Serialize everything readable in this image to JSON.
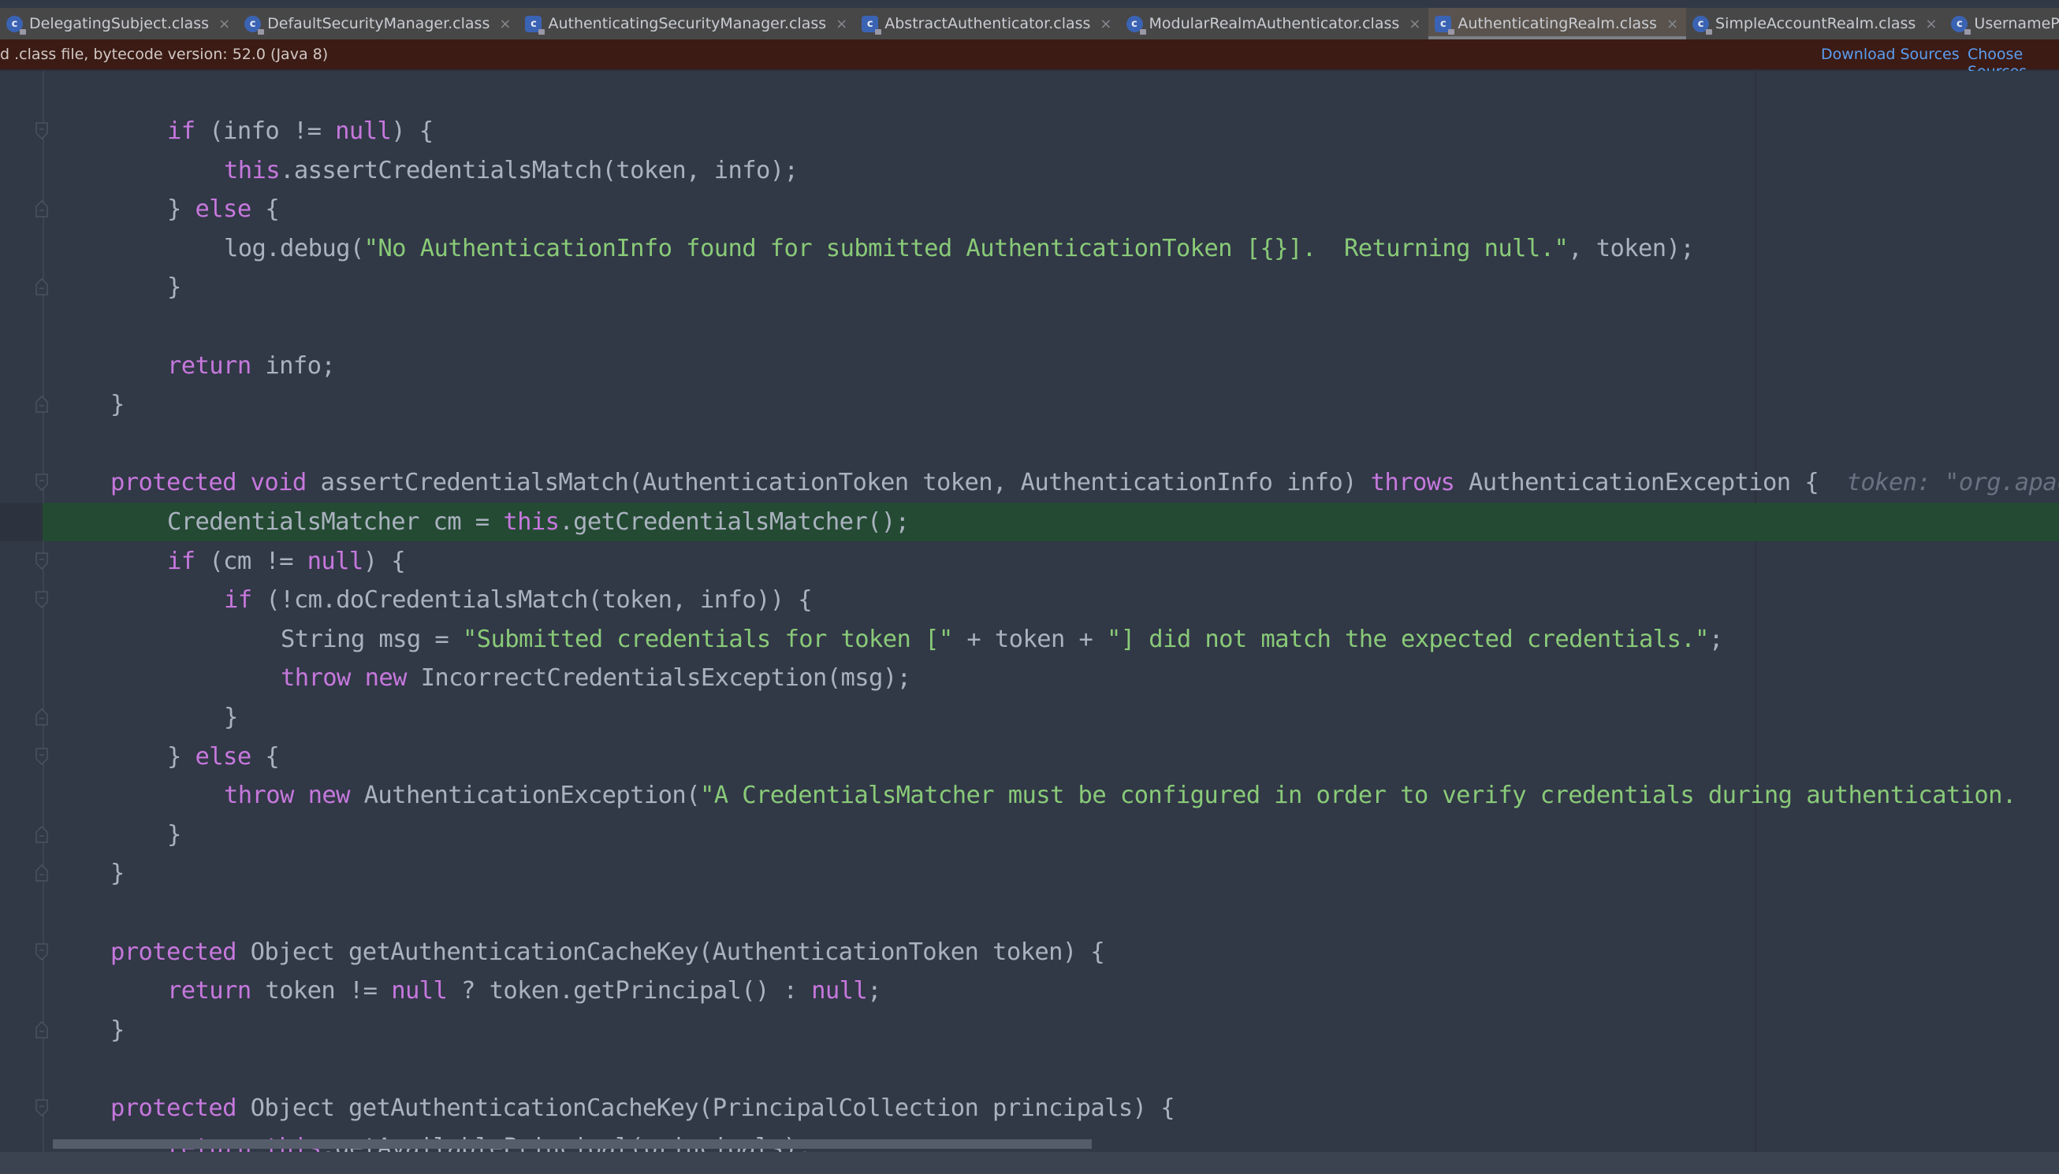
{
  "tabs": [
    {
      "label": "DelegatingSubject.class",
      "icon": "class-icon",
      "active": false
    },
    {
      "label": "DefaultSecurityManager.class",
      "icon": "class-icon",
      "active": false
    },
    {
      "label": "AuthenticatingSecurityManager.class",
      "icon": "abstract-class-icon",
      "active": false
    },
    {
      "label": "AbstractAuthenticator.class",
      "icon": "abstract-class-icon",
      "active": false
    },
    {
      "label": "ModularRealmAuthenticator.class",
      "icon": "class-icon",
      "active": false
    },
    {
      "label": "AuthenticatingRealm.class",
      "icon": "abstract-class-icon",
      "active": true
    },
    {
      "label": "SimpleAccountRealm.class",
      "icon": "class-icon",
      "active": false
    },
    {
      "label": "UsernamePasswordToken.class",
      "icon": "class-icon",
      "active": false
    }
  ],
  "tab_close_glyph": "×",
  "tab_icon_letter": "c",
  "notice": {
    "text": "d .class file, bytecode version: 52.0 (Java 8)",
    "download_sources": "Download Sources",
    "choose_sources": "Choose Sources..."
  },
  "editor": {
    "highlighted_line_index": 10,
    "lines": [
      {
        "indent": 1,
        "tokens": [
          {
            "t": "if",
            "c": "kw"
          },
          {
            "t": " (info != "
          },
          {
            "t": "null",
            "c": "kw"
          },
          {
            "t": ") {"
          }
        ]
      },
      {
        "indent": 2,
        "tokens": [
          {
            "t": "this",
            "c": "kw"
          },
          {
            "t": ".assertCredentialsMatch(token, info);"
          }
        ]
      },
      {
        "indent": 1,
        "tokens": [
          {
            "t": "} "
          },
          {
            "t": "else",
            "c": "kw"
          },
          {
            "t": " {"
          }
        ]
      },
      {
        "indent": 2,
        "tokens": [
          {
            "t": "log.debug("
          },
          {
            "t": "\"No AuthenticationInfo found for submitted AuthenticationToken [{}].  Returning null.\"",
            "c": "str"
          },
          {
            "t": ", token);"
          }
        ]
      },
      {
        "indent": 1,
        "tokens": [
          {
            "t": "}"
          }
        ]
      },
      {
        "indent": 0,
        "tokens": []
      },
      {
        "indent": 1,
        "tokens": [
          {
            "t": "return",
            "c": "kw"
          },
          {
            "t": " info;"
          }
        ]
      },
      {
        "indent": 0,
        "tokens": [
          {
            "t": "}"
          }
        ]
      },
      {
        "indent": 0,
        "tokens": []
      },
      {
        "indent": 0,
        "tokens": [
          {
            "t": "protected",
            "c": "kw"
          },
          {
            "t": " "
          },
          {
            "t": "void",
            "c": "kw"
          },
          {
            "t": " assertCredentialsMatch(AuthenticationToken token, AuthenticationInfo info) "
          },
          {
            "t": "throws",
            "c": "kw"
          },
          {
            "t": " AuthenticationException {  "
          },
          {
            "t": "token: \"org.apache.shiro.authc.UsernamePasswordToken",
            "c": "hint"
          }
        ]
      },
      {
        "indent": 1,
        "tokens": [
          {
            "t": "CredentialsMatcher cm = "
          },
          {
            "t": "this",
            "c": "kw"
          },
          {
            "t": ".getCredentialsMatcher();"
          }
        ]
      },
      {
        "indent": 1,
        "tokens": [
          {
            "t": "if",
            "c": "kw"
          },
          {
            "t": " (cm != "
          },
          {
            "t": "null",
            "c": "kw"
          },
          {
            "t": ") {"
          }
        ]
      },
      {
        "indent": 2,
        "tokens": [
          {
            "t": "if",
            "c": "kw"
          },
          {
            "t": " (!cm.doCredentialsMatch(token, info)) {"
          }
        ]
      },
      {
        "indent": 3,
        "tokens": [
          {
            "t": "String msg = "
          },
          {
            "t": "\"Submitted credentials for token [\"",
            "c": "str"
          },
          {
            "t": " + token + "
          },
          {
            "t": "\"] did not match the expected credentials.\"",
            "c": "str"
          },
          {
            "t": ";"
          }
        ]
      },
      {
        "indent": 3,
        "tokens": [
          {
            "t": "throw",
            "c": "kw"
          },
          {
            "t": " "
          },
          {
            "t": "new",
            "c": "kw"
          },
          {
            "t": " IncorrectCredentialsException(msg);"
          }
        ]
      },
      {
        "indent": 2,
        "tokens": [
          {
            "t": "}"
          }
        ]
      },
      {
        "indent": 1,
        "tokens": [
          {
            "t": "} "
          },
          {
            "t": "else",
            "c": "kw"
          },
          {
            "t": " {"
          }
        ]
      },
      {
        "indent": 2,
        "tokens": [
          {
            "t": "throw",
            "c": "kw"
          },
          {
            "t": " "
          },
          {
            "t": "new",
            "c": "kw"
          },
          {
            "t": " AuthenticationException("
          },
          {
            "t": "\"A CredentialsMatcher must be configured in order to verify credentials during authentication.",
            "c": "str"
          }
        ]
      },
      {
        "indent": 1,
        "tokens": [
          {
            "t": "}"
          }
        ]
      },
      {
        "indent": 0,
        "tokens": [
          {
            "t": "}"
          }
        ]
      },
      {
        "indent": 0,
        "tokens": []
      },
      {
        "indent": 0,
        "tokens": [
          {
            "t": "protected",
            "c": "kw"
          },
          {
            "t": " Object getAuthenticationCacheKey(AuthenticationToken token) {"
          }
        ]
      },
      {
        "indent": 1,
        "tokens": [
          {
            "t": "return",
            "c": "kw"
          },
          {
            "t": " token != "
          },
          {
            "t": "null",
            "c": "kw"
          },
          {
            "t": " ? token.getPrincipal() : "
          },
          {
            "t": "null",
            "c": "kw"
          },
          {
            "t": ";"
          }
        ]
      },
      {
        "indent": 0,
        "tokens": [
          {
            "t": "}"
          }
        ]
      },
      {
        "indent": 0,
        "tokens": []
      },
      {
        "indent": 0,
        "tokens": [
          {
            "t": "protected",
            "c": "kw"
          },
          {
            "t": " Object getAuthenticationCacheKey(PrincipalCollection principals) {"
          }
        ]
      },
      {
        "indent": 1,
        "tokens": [
          {
            "t": "return",
            "c": "kw"
          },
          {
            "t": " "
          },
          {
            "t": "this",
            "c": "kw"
          },
          {
            "t": ".getAvailablePrincipal(principals);"
          }
        ]
      }
    ],
    "folds": [
      {
        "line": 0,
        "kind": "open"
      },
      {
        "line": 2,
        "kind": "close"
      },
      {
        "line": 4,
        "kind": "close"
      },
      {
        "line": 7,
        "kind": "close"
      },
      {
        "line": 9,
        "kind": "open"
      },
      {
        "line": 11,
        "kind": "open"
      },
      {
        "line": 12,
        "kind": "open"
      },
      {
        "line": 15,
        "kind": "close"
      },
      {
        "line": 16,
        "kind": "open"
      },
      {
        "line": 18,
        "kind": "close"
      },
      {
        "line": 19,
        "kind": "close"
      },
      {
        "line": 21,
        "kind": "open"
      },
      {
        "line": 23,
        "kind": "close"
      },
      {
        "line": 25,
        "kind": "open"
      }
    ]
  },
  "colors": {
    "keyword": "#c678dd",
    "string": "#89ca78",
    "text": "#aab2bf",
    "highlight_line": "#244a33",
    "notice_bg": "#3c1b15",
    "link": "#5a9ef0"
  }
}
